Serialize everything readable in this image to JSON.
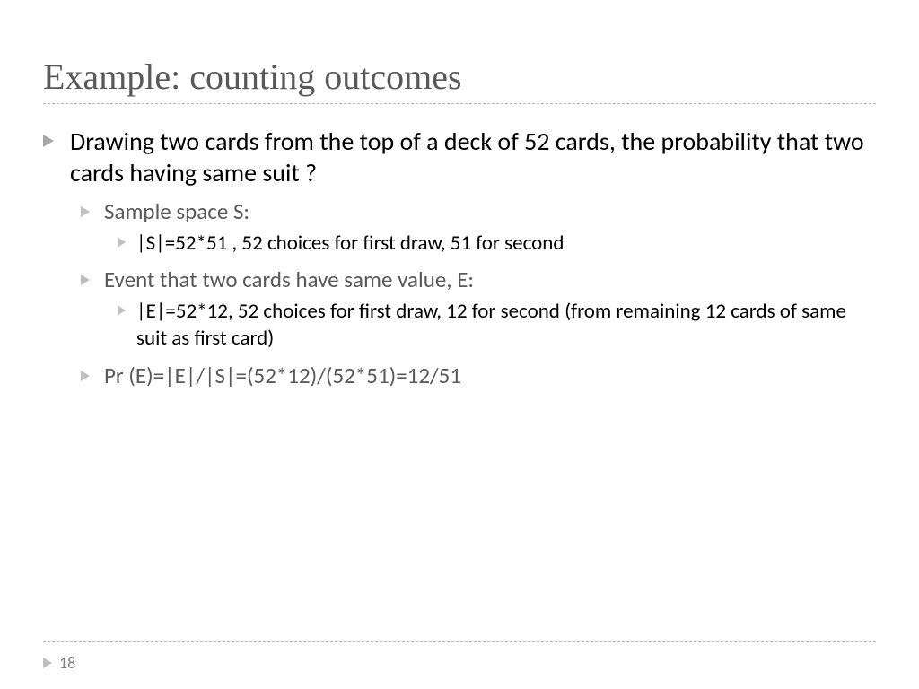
{
  "title": "Example: counting outcomes",
  "page_number": "18",
  "content": {
    "main_point": "Drawing two cards from the top of a deck of 52 cards, the probability that two cards having same suit ?",
    "sample_label": "Sample space S:",
    "sample_detail": "|S|=52*51 , 52 choices for first draw, 51 for second",
    "event_label": "Event that two cards have same value, E:",
    "event_detail": "|E|=52*12, 52 choices for first draw, 12 for second (from remaining 12 cards of same suit as first card)",
    "result": "Pr (E)=|E|/|S|=(52*12)/(52*51)=12/51"
  }
}
